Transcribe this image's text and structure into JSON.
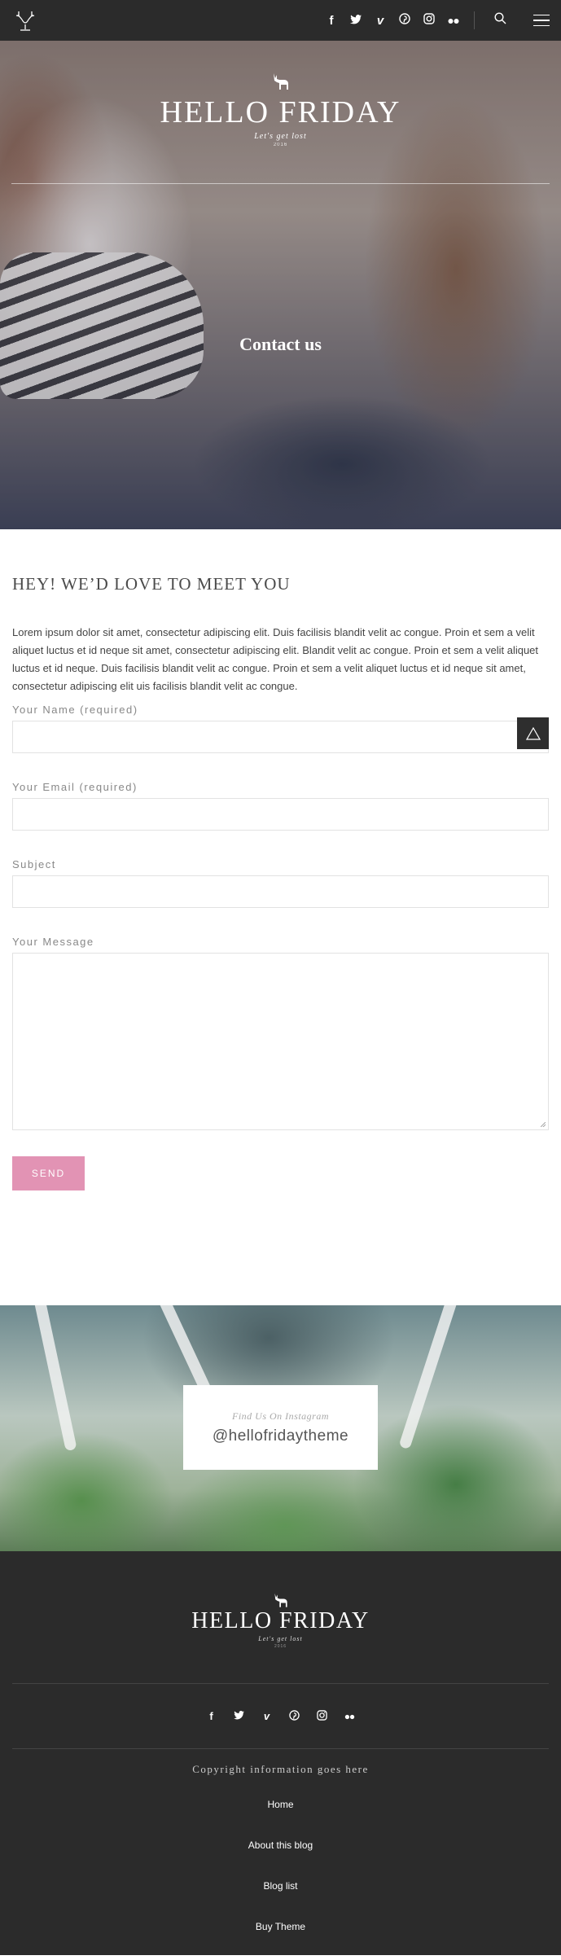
{
  "topbar": {
    "social_icons": [
      {
        "name": "facebook-icon",
        "glyph": "f"
      },
      {
        "name": "twitter-icon",
        "glyph": "🐦"
      },
      {
        "name": "vimeo-icon",
        "glyph": "v"
      },
      {
        "name": "pinterest-icon",
        "glyph": "℗"
      },
      {
        "name": "instagram-icon",
        "glyph": "◎"
      },
      {
        "name": "flickr-icon",
        "glyph": "••"
      }
    ]
  },
  "hero": {
    "brand_title": "HELLO FRIDAY",
    "brand_tagline": "Let's get lost",
    "brand_est": "2016",
    "page_title": "Contact us"
  },
  "contact": {
    "heading": "HEY! WE’D LOVE TO MEET YOU",
    "intro": "Lorem ipsum dolor sit amet, consectetur adipiscing elit. Duis facilisis blandit velit ac congue. Proin et sem a velit aliquet luctus et id neque sit amet, consectetur adipiscing elit. Blandit velit ac congue. Proin et sem a velit aliquet luctus et id neque. Duis facilisis blandit velit ac congue. Proin et sem a velit aliquet luctus et id neque sit amet, consectetur adipiscing elit uis facilisis blandit velit ac congue.",
    "name_label": "Your Name (required)",
    "email_label": "Your Email (required)",
    "subject_label": "Subject",
    "message_label": "Your Message",
    "send_label": "SEND"
  },
  "instagram": {
    "find_label": "Find Us On Instagram",
    "handle": "@hellofridaytheme"
  },
  "footer": {
    "brand_title": "HELLO FRIDAY",
    "brand_tagline": "Let's get lost",
    "brand_est": "2016",
    "copyright": "Copyright information goes here",
    "links": [
      "Home",
      "About this blog",
      "Blog list",
      "Buy Theme"
    ]
  },
  "colors": {
    "dark": "#2b2b2b",
    "accent_pink": "#e293b4"
  }
}
